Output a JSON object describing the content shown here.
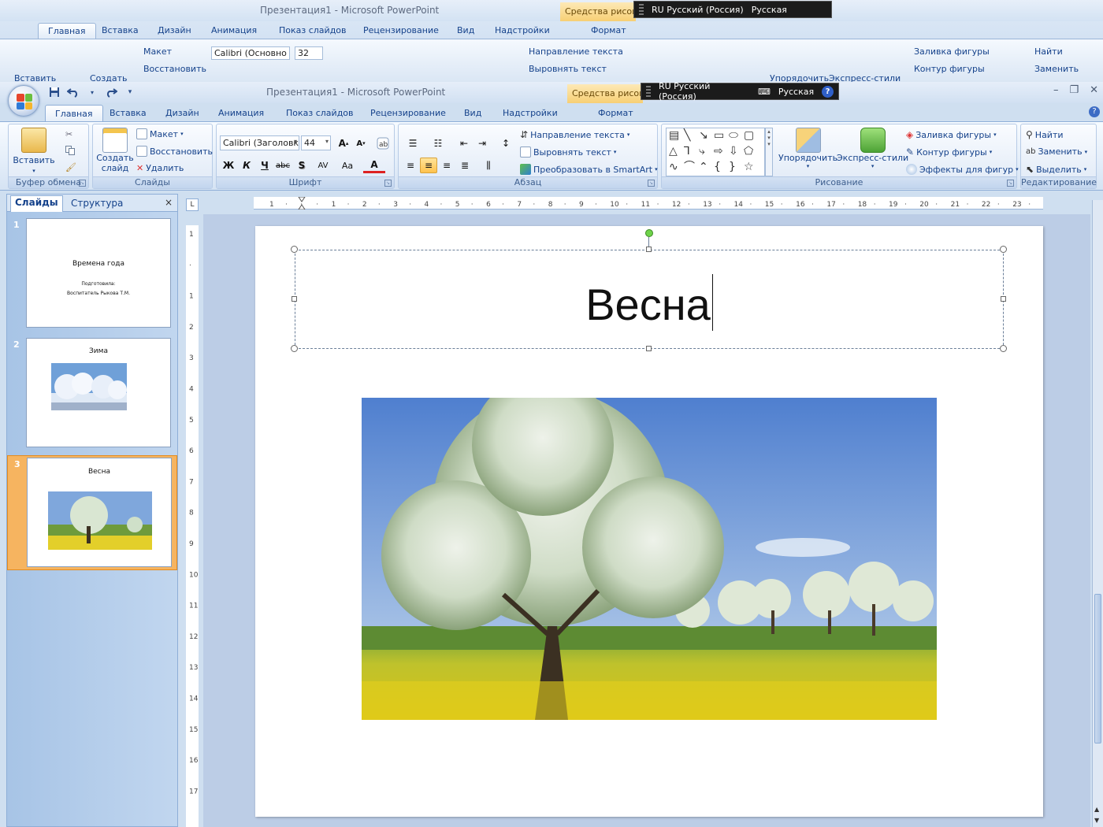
{
  "back_window": {
    "title": "Презентация1 - Microsoft PowerPoint",
    "tabs": [
      "Главная",
      "Вставка",
      "Дизайн",
      "Анимация",
      "Показ слайдов",
      "Рецензирование",
      "Вид",
      "Надстройки",
      "Формат"
    ],
    "context_label": "Средства рисова",
    "language": "RU Русский (Россия)",
    "keyboard": "Русская",
    "paste": "Вставить",
    "create": "Создать",
    "layout": "Макет",
    "reset": "Восстановить",
    "font_name": "Calibri (Основно",
    "font_size": "32",
    "text_direction": "Направление текста",
    "align_text": "Выровнять текст",
    "arrange": "Упорядочить",
    "quick_styles": "Экспресс-стили",
    "shape_fill": "Заливка фигуры",
    "shape_outline": "Контур фигуры",
    "find": "Найти",
    "replace": "Заменить"
  },
  "window": {
    "title": "Презентация1 - Microsoft PowerPoint",
    "context_label": "Средства рисова",
    "language": "RU Русский (Россия)",
    "keyboard": "Русская",
    "help": "?"
  },
  "tabs": {
    "home": "Главная",
    "insert": "Вставка",
    "design": "Дизайн",
    "animation": "Анимация",
    "slideshow": "Показ слайдов",
    "review": "Рецензирование",
    "view": "Вид",
    "addins": "Надстройки",
    "format": "Формат"
  },
  "ribbon": {
    "clipboard": {
      "label": "Буфер обмена",
      "paste": "Вставить"
    },
    "slides": {
      "label": "Слайды",
      "new_slide_1": "Создать",
      "new_slide_2": "слайд",
      "layout": "Макет",
      "reset": "Восстановить",
      "delete": "Удалить"
    },
    "font": {
      "label": "Шрифт",
      "name": "Calibri (Заголовк",
      "size": "44",
      "bold": "Ж",
      "italic": "К",
      "underline": "Ч",
      "strike": "abc",
      "shadow": "S",
      "spacing": "AV",
      "case": "Aa",
      "color": "A"
    },
    "paragraph": {
      "label": "Абзац",
      "text_direction": "Направление текста",
      "align_text": "Выровнять текст",
      "smartart": "Преобразовать в SmartArt"
    },
    "drawing": {
      "label": "Рисование",
      "arrange": "Упорядочить",
      "quick_styles": "Экспресс-стили",
      "fill": "Заливка фигуры",
      "outline": "Контур фигуры",
      "effects": "Эффекты для фигур"
    },
    "editing": {
      "label": "Редактирование",
      "find": "Найти",
      "replace": "Заменить",
      "select": "Выделить"
    }
  },
  "pane": {
    "tab_slides": "Слайды",
    "tab_outline": "Структура",
    "close": "×",
    "thumbnails": [
      {
        "number": "1",
        "title": "Времена года",
        "sub1": "Подготовила:",
        "sub2": "Воспитатель Рыкова Т.М."
      },
      {
        "number": "2",
        "title": "Зима"
      },
      {
        "number": "3",
        "title": "Весна"
      }
    ]
  },
  "ruler": {
    "corner": "L",
    "h_labels": [
      "1",
      "·",
      "1",
      "2",
      "3",
      "4",
      "5",
      "6",
      "7",
      "8",
      "9",
      "10",
      "11",
      "12",
      "13",
      "14",
      "15",
      "16",
      "17",
      "18",
      "19",
      "20",
      "21",
      "22",
      "23"
    ],
    "v_labels": [
      "1",
      "·",
      "1",
      "2",
      "3",
      "4",
      "5",
      "6",
      "7",
      "8",
      "9",
      "10",
      "11",
      "12",
      "13",
      "14",
      "15",
      "16",
      "17"
    ]
  },
  "slide": {
    "title": "Весна"
  },
  "colors": {
    "selection_orange": "#f6b460",
    "ribbon_text": "#15428b",
    "rotate_handle": "#6fd34a"
  }
}
